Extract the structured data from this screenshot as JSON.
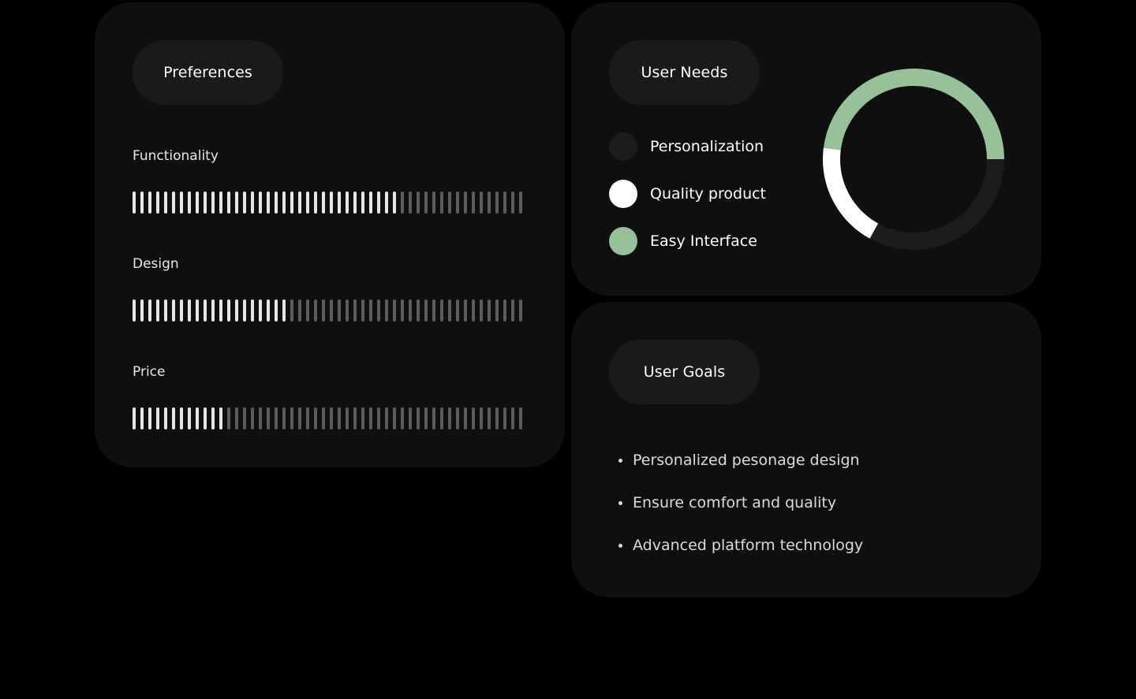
{
  "colors": {
    "background": "#000000",
    "card": "#0f0f0f",
    "pill": "#1a1a1a",
    "bar_active": "#e6e6e6",
    "bar_inactive": "#5c5c5c",
    "accent_green": "#97c197",
    "white": "#ffffff",
    "dark_segment": "#1c1c1c"
  },
  "preferences": {
    "title": "Preferences",
    "items": [
      {
        "label": "Functionality",
        "level": 0.68
      },
      {
        "label": "Design",
        "level": 0.4
      },
      {
        "label": "Price",
        "level": 0.24
      }
    ]
  },
  "user_needs": {
    "title": "User Needs",
    "items": [
      {
        "label": "Personalization",
        "color": "#1c1c1c",
        "share": 0.33
      },
      {
        "label": "Quality product",
        "color": "#ffffff",
        "share": 0.19
      },
      {
        "label": "Easy Interface",
        "color": "#97c197",
        "share": 0.48
      }
    ]
  },
  "user_goals": {
    "title": "User Goals",
    "items": [
      "Personalized pesonage design",
      "Ensure comfort and quality",
      "Advanced platform technology"
    ]
  }
}
